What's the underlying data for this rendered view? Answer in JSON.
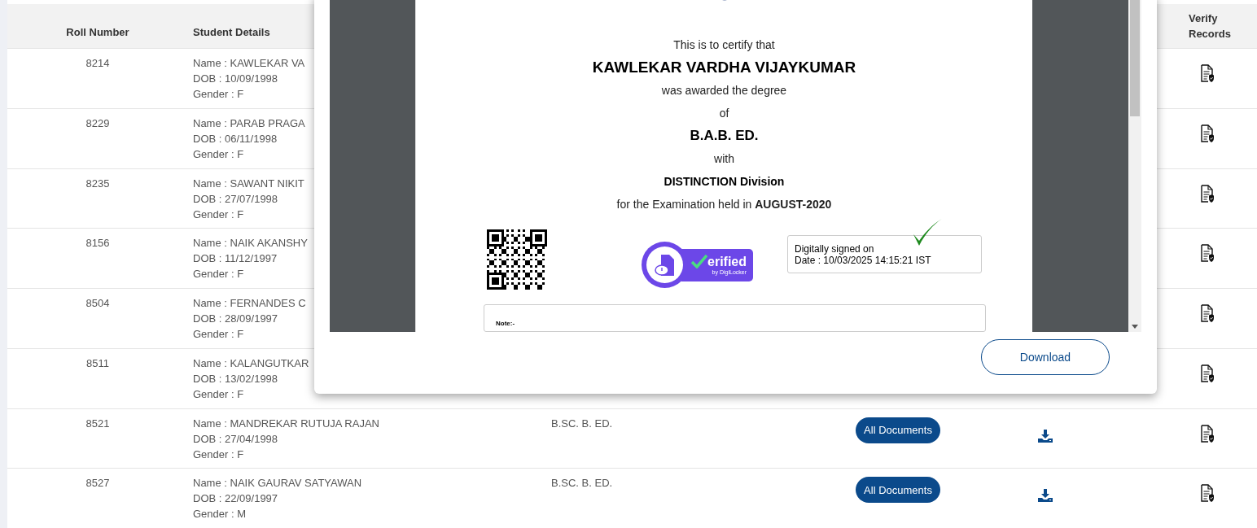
{
  "table": {
    "headers": {
      "roll_number": "Roll Number",
      "student_details": "Student Details",
      "verify_records": "Verify Records"
    },
    "rows": [
      {
        "roll": "8214",
        "name": "Name : KAWLEKAR VA",
        "dob": "DOB : 10/09/1998",
        "gender": "Gender : F"
      },
      {
        "roll": "8229",
        "name": "Name : PARAB PRAGA",
        "dob": "DOB : 06/11/1998",
        "gender": "Gender : F"
      },
      {
        "roll": "8235",
        "name": "Name : SAWANT NIKIT",
        "dob": "DOB : 27/07/1998",
        "gender": "Gender : F"
      },
      {
        "roll": "8156",
        "name": "Name : NAIK AKANSHY",
        "dob": "DOB : 11/12/1997",
        "gender": "Gender : F"
      },
      {
        "roll": "8504",
        "name": "Name : FERNANDES C",
        "dob": "DOB : 28/09/1997",
        "gender": "Gender : F"
      },
      {
        "roll": "8511",
        "name": "Name : KALANGUTKAR",
        "dob": "DOB : 13/02/1998",
        "gender": "Gender : F"
      },
      {
        "roll": "8521",
        "name": "Name : MANDREKAR RUTUJA RAJAN",
        "dob": "DOB : 27/04/1998",
        "gender": "Gender : F",
        "course": "B.SC. B. ED.",
        "documents_button": "All Documents"
      },
      {
        "roll": "8527",
        "name": "Name : NAIK GAURAV SATYAWAN",
        "dob": "DOB : 22/09/1997",
        "gender": "Gender : M",
        "course": "B.SC. B. ED.",
        "documents_button": "All Documents"
      }
    ]
  },
  "modal": {
    "certificate": {
      "lines": [
        {
          "kind": "plain",
          "text": "This is to certify that"
        },
        {
          "kind": "name",
          "text": "KAWLEKAR VARDHA VIJAYKUMAR"
        },
        {
          "kind": "plain",
          "text": "was awarded the degree"
        },
        {
          "kind": "plain",
          "text": "of"
        },
        {
          "kind": "degree",
          "text": "B.A.B. ED."
        },
        {
          "kind": "plain",
          "text": "with"
        },
        {
          "kind": "bold",
          "text": "DISTINCTION Division"
        },
        {
          "kind": "plain",
          "text": "for the Examination held in **AUGUST-2020**"
        }
      ],
      "verified_badge": {
        "text": "erified",
        "subtext": "by DigiLocker"
      },
      "signature": [
        "Digitally signed on",
        "Date : 10/03/2025 14:15:21 IST"
      ],
      "note": "Note:-"
    },
    "download_button": "Download"
  }
}
